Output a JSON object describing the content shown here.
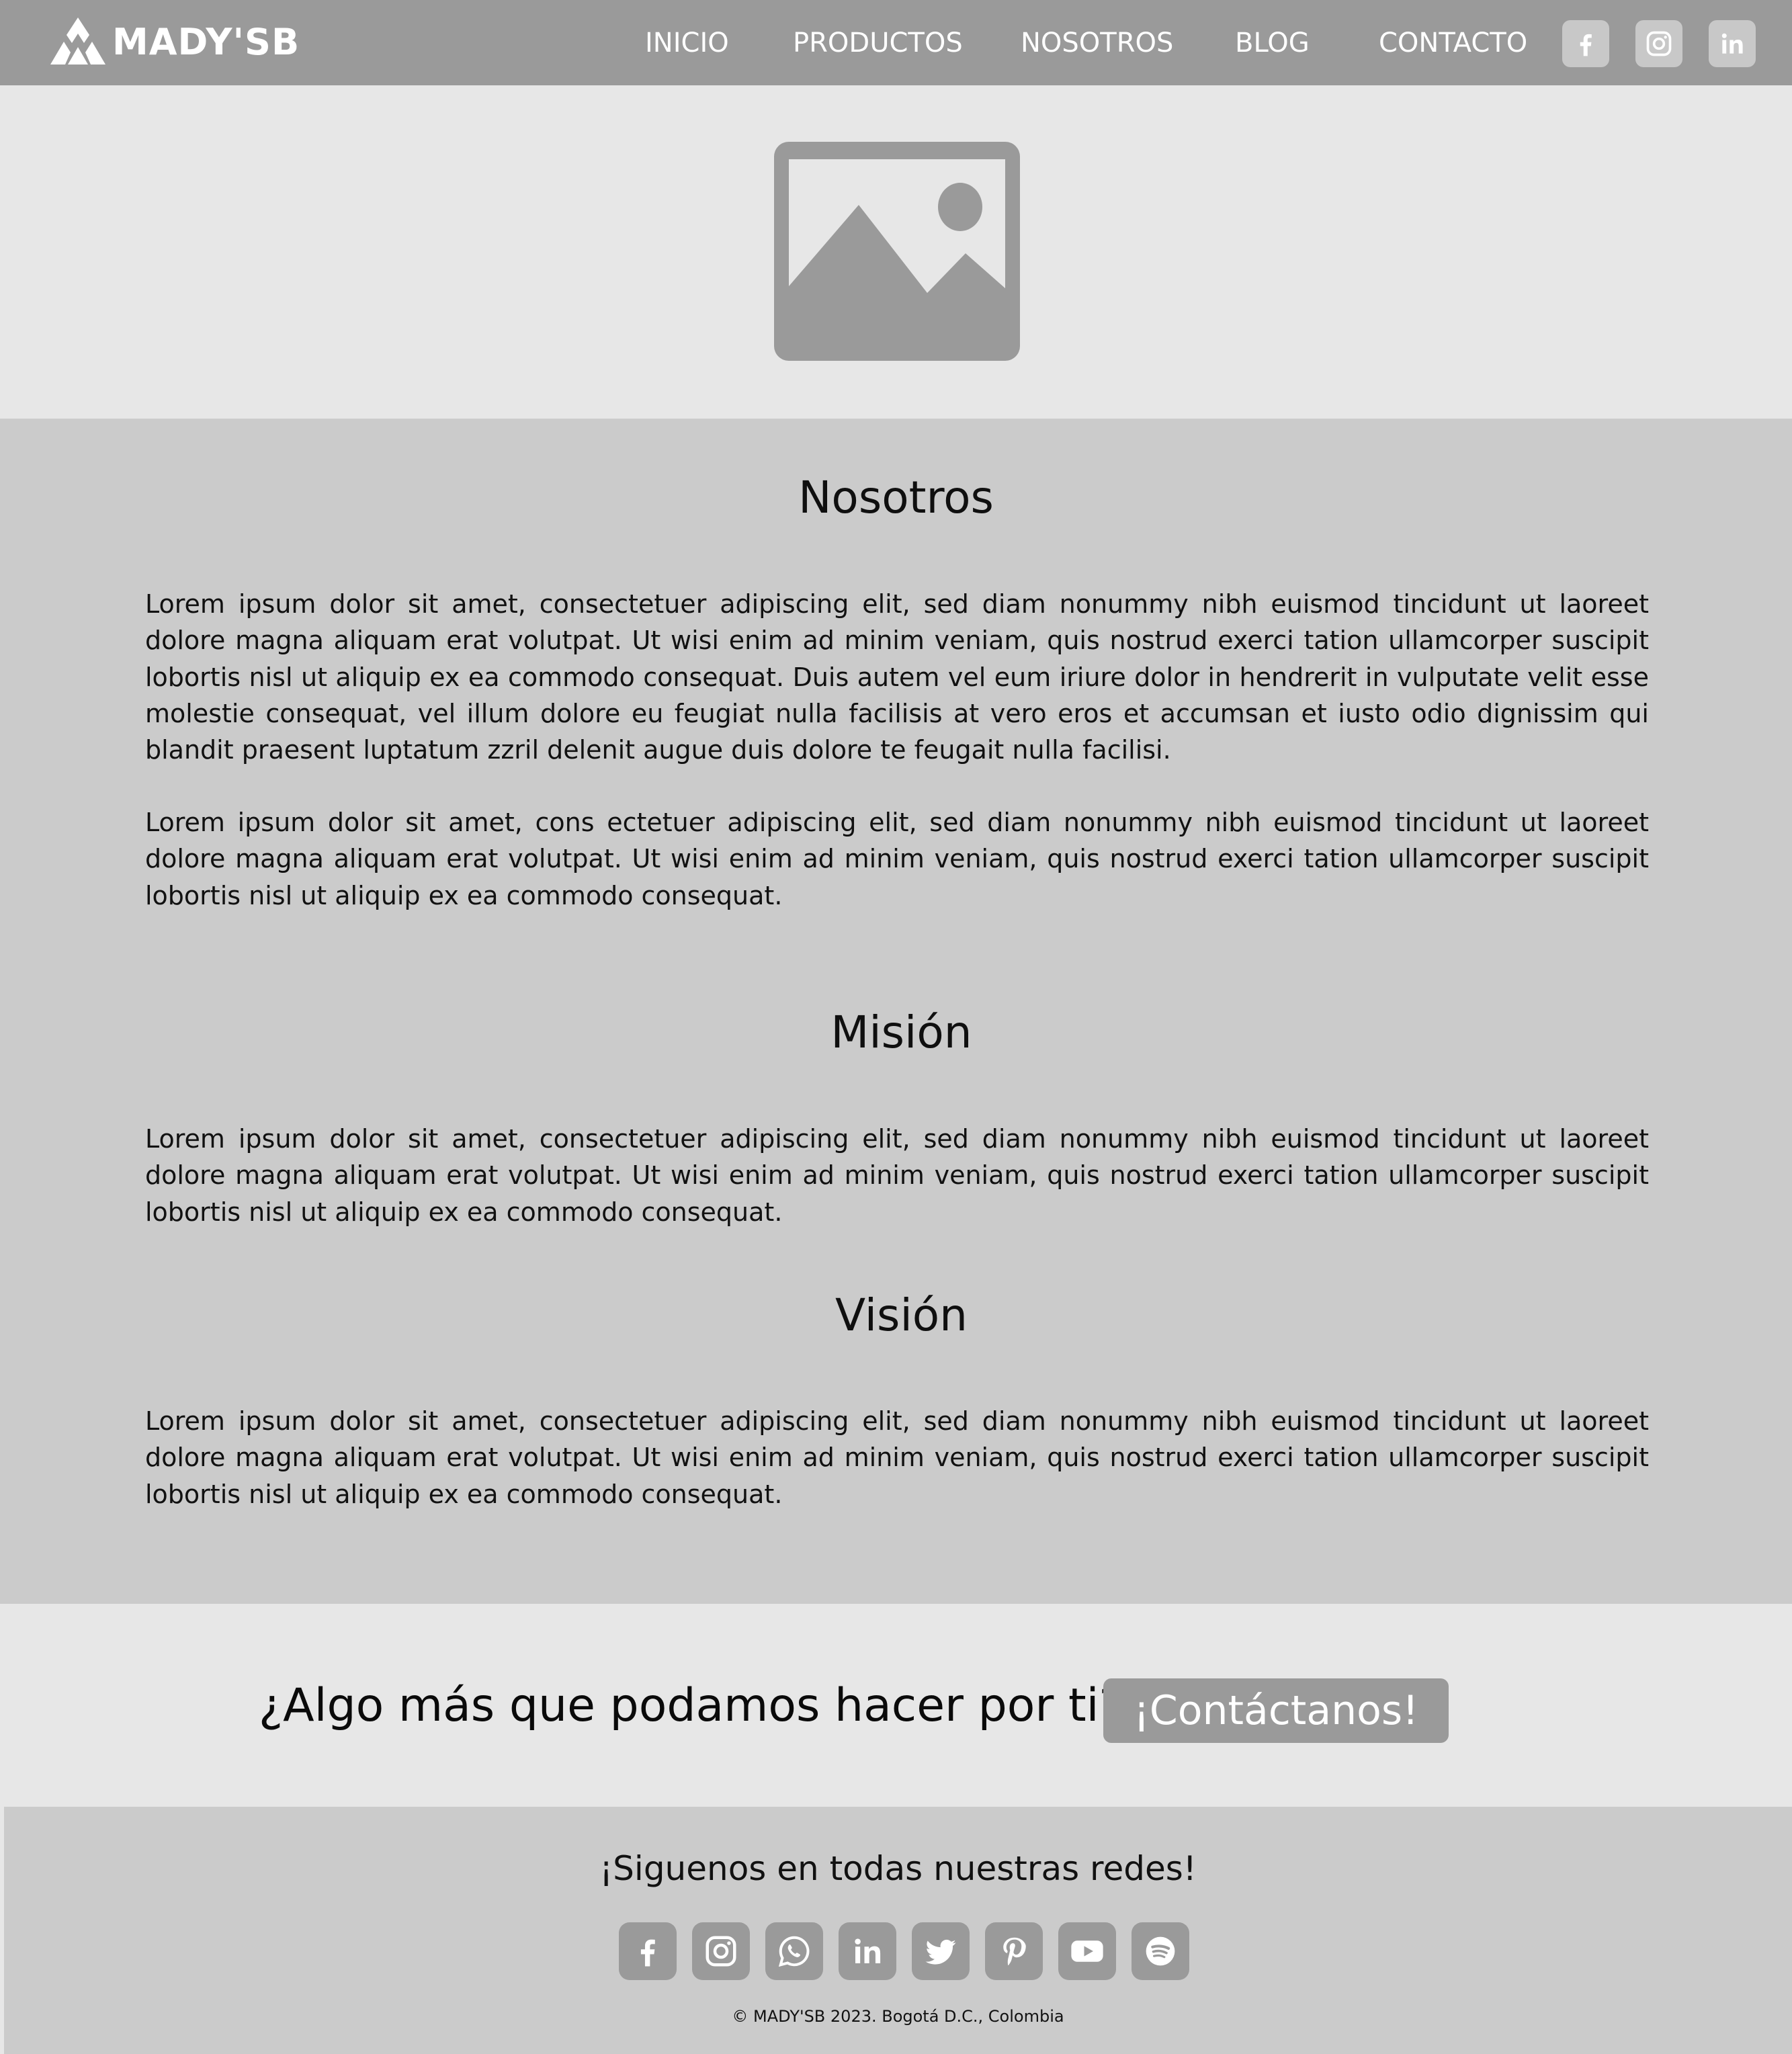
{
  "brand": {
    "name": "MADY'SB"
  },
  "nav": {
    "items": [
      {
        "label": "INICIO"
      },
      {
        "label": "PRODUCTOS"
      },
      {
        "label": "NOSOTROS"
      },
      {
        "label": "BLOG"
      },
      {
        "label": "CONTACTO"
      }
    ],
    "social_icons": [
      "facebook-icon",
      "instagram-icon",
      "linkedin-icon"
    ]
  },
  "hero": {
    "image_icon": "image-placeholder-icon"
  },
  "about": {
    "title": "Nosotros",
    "paragraphs": [
      "Lorem ipsum dolor sit amet, consectetuer adipiscing elit, sed diam nonummy nibh euismod tincidunt ut laoreet dolore magna aliquam erat volutpat. Ut wisi enim ad minim veniam, quis nostrud exerci tation ullamcorper suscipit lobortis nisl ut aliquip ex ea commodo consequat. Duis autem vel eum iriure dolor in hendrerit in vulputate velit esse molestie consequat, vel illum dolore eu feugiat nulla facilisis at vero eros et accumsan et iusto odio dignissim qui blandit praesent luptatum zzril delenit augue duis dolore te feugait nulla facilisi.",
      "Lorem ipsum dolor sit amet, cons ectetuer adipiscing elit, sed diam nonummy nibh euismod tincidunt ut laoreet dolore magna aliquam erat volutpat. Ut wisi enim ad minim veniam, quis nostrud exerci tation ullamcorper suscipit lobortis nisl ut aliquip ex ea commodo consequat."
    ]
  },
  "mission": {
    "title": "Misión",
    "text": "Lorem ipsum dolor sit amet, consectetuer adipiscing elit, sed diam nonummy nibh euismod tincidunt ut laoreet dolore magna aliquam erat volutpat. Ut wisi enim ad minim veniam, quis nostrud exerci tation ullamcorper suscipit lobortis nisl ut aliquip ex ea commodo consequat."
  },
  "vision": {
    "title": "Visión",
    "text": "Lorem ipsum dolor sit amet, consectetuer adipiscing elit, sed diam nonummy nibh euismod tincidunt ut laoreet dolore magna aliquam erat volutpat. Ut wisi enim ad minim veniam, quis nostrud exerci tation ullamcorper suscipit lobortis nisl ut aliquip ex ea commodo consequat."
  },
  "cta": {
    "question": "¿Algo más que podamos hacer por ti?",
    "button_label": "¡Contáctanos!"
  },
  "footer": {
    "title": "¡Siguenos en todas nuestras redes!",
    "social_icons": [
      "facebook-icon",
      "instagram-icon",
      "whatsapp-icon",
      "linkedin-icon",
      "twitter-icon",
      "pinterest-icon",
      "youtube-icon",
      "spotify-icon"
    ],
    "copyright": "© MADY'SB 2023. Bogotá D.C., Colombia"
  },
  "colors": {
    "nav_bg": "#9a9a9a",
    "hero_bg": "#e7e7e7",
    "content_bg": "#cbcbcb",
    "button_bg": "#9a9a9a",
    "icon_tile_light": "#c8c8c8",
    "text_dark": "#111111",
    "text_light": "#ffffff"
  }
}
